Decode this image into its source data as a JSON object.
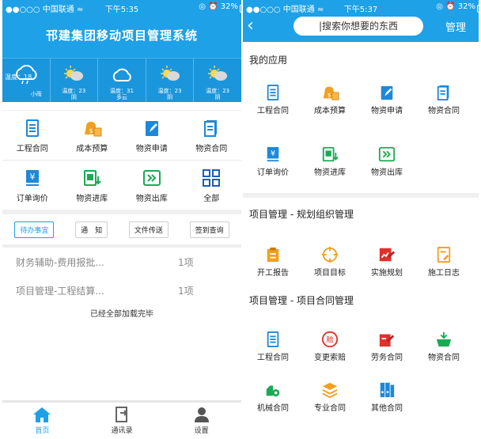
{
  "left": {
    "status": {
      "carrier": "●●○○○ 中国联通 ≈",
      "time": "下午5:35",
      "right": "◎ ⏰ 32%"
    },
    "title": "邗建集团移动项目管理系统",
    "weather": [
      {
        "temp": "温度：18",
        "label": "小雨",
        "icon": "cloud-rain-icon"
      },
      {
        "l1": "温度：23",
        "l2": "阴",
        "icon": "sun-cloud-icon"
      },
      {
        "l1": "温度：31",
        "l2": "多云",
        "icon": "cloud-icon"
      },
      {
        "l1": "温度：23",
        "l2": "阴",
        "icon": "sun-cloud-icon"
      },
      {
        "l1": "温度：23",
        "l2": "阴",
        "icon": "sun-cloud-icon"
      }
    ],
    "apps": [
      {
        "label": "工程合同",
        "icon": "doc-list-icon"
      },
      {
        "label": "成本预算",
        "icon": "money-bag-icon"
      },
      {
        "label": "物资申请",
        "icon": "edit-doc-icon"
      },
      {
        "label": "物资合同",
        "icon": "doc-stack-icon"
      },
      {
        "label": "订单询价",
        "icon": "yen-doc-icon"
      },
      {
        "label": "物资进库",
        "icon": "stock-in-icon"
      },
      {
        "label": "物资出库",
        "icon": "stock-out-icon"
      },
      {
        "label": "全部",
        "icon": "grid-icon"
      }
    ],
    "tabs": [
      "待办事宜",
      "通　知",
      "文件传送",
      "签到查询"
    ],
    "todo": [
      {
        "title": "财务辅助-费用报批...",
        "count": "1项"
      },
      {
        "title": "项目管理-工程结算...",
        "count": "1项"
      }
    ],
    "loaded": "已经全部加载完毕",
    "tabbar": [
      {
        "label": "首页",
        "icon": "home-icon"
      },
      {
        "label": "通讯录",
        "icon": "contacts-icon"
      },
      {
        "label": "设置",
        "icon": "person-icon"
      }
    ]
  },
  "right": {
    "status": {
      "carrier": "●●○○○ 中国联通 ≈",
      "time": "下午5:37",
      "right": "◎ ⏰ 32%"
    },
    "back": "‹",
    "search_placeholder": "|搜索你想要的东西",
    "manage": "管理",
    "sections": [
      {
        "title": "我的应用",
        "items": [
          {
            "label": "工程合同",
            "icon": "doc-list-icon"
          },
          {
            "label": "成本预算",
            "icon": "money-bag-icon"
          },
          {
            "label": "物资申请",
            "icon": "edit-doc-icon"
          },
          {
            "label": "物资合同",
            "icon": "doc-stack-icon"
          },
          {
            "label": "订单询价",
            "icon": "yen-doc-icon"
          },
          {
            "label": "物资进库",
            "icon": "stock-in-icon"
          },
          {
            "label": "物资出库",
            "icon": "stock-out-icon"
          }
        ]
      },
      {
        "title": "项目管理 - 规划组织管理",
        "items": [
          {
            "label": "开工报告",
            "icon": "clipboard-icon"
          },
          {
            "label": "项目目标",
            "icon": "target-icon"
          },
          {
            "label": "实施规划",
            "icon": "plan-icon"
          },
          {
            "label": "施工日志",
            "icon": "log-icon"
          }
        ]
      },
      {
        "title": "项目管理 - 项目合同管理",
        "items": [
          {
            "label": "工程合同",
            "icon": "doc-list-icon"
          },
          {
            "label": "变更索赔",
            "icon": "claim-icon"
          },
          {
            "label": "劳务合同",
            "icon": "labor-icon"
          },
          {
            "label": "物资合同",
            "icon": "basket-icon"
          },
          {
            "label": "机械合同",
            "icon": "machine-icon"
          },
          {
            "label": "专业合同",
            "icon": "layers-icon"
          },
          {
            "label": "其他合同",
            "icon": "binders-icon"
          }
        ]
      }
    ]
  },
  "colors": {
    "brand": "#1ea1e6",
    "blue": "#1e88d8",
    "orange": "#f0a020",
    "green": "#1aaa55",
    "red": "#e0302a"
  }
}
